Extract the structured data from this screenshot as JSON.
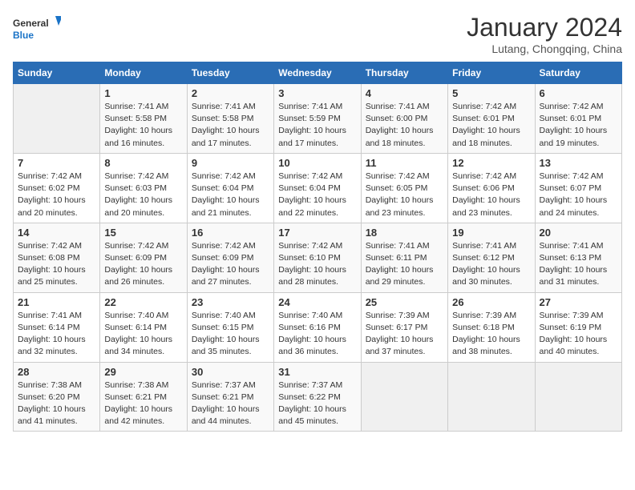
{
  "header": {
    "logo_line1": "General",
    "logo_line2": "Blue",
    "month_year": "January 2024",
    "location": "Lutang, Chongqing, China"
  },
  "columns": [
    "Sunday",
    "Monday",
    "Tuesday",
    "Wednesday",
    "Thursday",
    "Friday",
    "Saturday"
  ],
  "weeks": [
    [
      {
        "day": "",
        "info": ""
      },
      {
        "day": "1",
        "info": "Sunrise: 7:41 AM\nSunset: 5:58 PM\nDaylight: 10 hours\nand 16 minutes."
      },
      {
        "day": "2",
        "info": "Sunrise: 7:41 AM\nSunset: 5:58 PM\nDaylight: 10 hours\nand 17 minutes."
      },
      {
        "day": "3",
        "info": "Sunrise: 7:41 AM\nSunset: 5:59 PM\nDaylight: 10 hours\nand 17 minutes."
      },
      {
        "day": "4",
        "info": "Sunrise: 7:41 AM\nSunset: 6:00 PM\nDaylight: 10 hours\nand 18 minutes."
      },
      {
        "day": "5",
        "info": "Sunrise: 7:42 AM\nSunset: 6:01 PM\nDaylight: 10 hours\nand 18 minutes."
      },
      {
        "day": "6",
        "info": "Sunrise: 7:42 AM\nSunset: 6:01 PM\nDaylight: 10 hours\nand 19 minutes."
      }
    ],
    [
      {
        "day": "7",
        "info": "Sunrise: 7:42 AM\nSunset: 6:02 PM\nDaylight: 10 hours\nand 20 minutes."
      },
      {
        "day": "8",
        "info": "Sunrise: 7:42 AM\nSunset: 6:03 PM\nDaylight: 10 hours\nand 20 minutes."
      },
      {
        "day": "9",
        "info": "Sunrise: 7:42 AM\nSunset: 6:04 PM\nDaylight: 10 hours\nand 21 minutes."
      },
      {
        "day": "10",
        "info": "Sunrise: 7:42 AM\nSunset: 6:04 PM\nDaylight: 10 hours\nand 22 minutes."
      },
      {
        "day": "11",
        "info": "Sunrise: 7:42 AM\nSunset: 6:05 PM\nDaylight: 10 hours\nand 23 minutes."
      },
      {
        "day": "12",
        "info": "Sunrise: 7:42 AM\nSunset: 6:06 PM\nDaylight: 10 hours\nand 23 minutes."
      },
      {
        "day": "13",
        "info": "Sunrise: 7:42 AM\nSunset: 6:07 PM\nDaylight: 10 hours\nand 24 minutes."
      }
    ],
    [
      {
        "day": "14",
        "info": "Sunrise: 7:42 AM\nSunset: 6:08 PM\nDaylight: 10 hours\nand 25 minutes."
      },
      {
        "day": "15",
        "info": "Sunrise: 7:42 AM\nSunset: 6:09 PM\nDaylight: 10 hours\nand 26 minutes."
      },
      {
        "day": "16",
        "info": "Sunrise: 7:42 AM\nSunset: 6:09 PM\nDaylight: 10 hours\nand 27 minutes."
      },
      {
        "day": "17",
        "info": "Sunrise: 7:42 AM\nSunset: 6:10 PM\nDaylight: 10 hours\nand 28 minutes."
      },
      {
        "day": "18",
        "info": "Sunrise: 7:41 AM\nSunset: 6:11 PM\nDaylight: 10 hours\nand 29 minutes."
      },
      {
        "day": "19",
        "info": "Sunrise: 7:41 AM\nSunset: 6:12 PM\nDaylight: 10 hours\nand 30 minutes."
      },
      {
        "day": "20",
        "info": "Sunrise: 7:41 AM\nSunset: 6:13 PM\nDaylight: 10 hours\nand 31 minutes."
      }
    ],
    [
      {
        "day": "21",
        "info": "Sunrise: 7:41 AM\nSunset: 6:14 PM\nDaylight: 10 hours\nand 32 minutes."
      },
      {
        "day": "22",
        "info": "Sunrise: 7:40 AM\nSunset: 6:14 PM\nDaylight: 10 hours\nand 34 minutes."
      },
      {
        "day": "23",
        "info": "Sunrise: 7:40 AM\nSunset: 6:15 PM\nDaylight: 10 hours\nand 35 minutes."
      },
      {
        "day": "24",
        "info": "Sunrise: 7:40 AM\nSunset: 6:16 PM\nDaylight: 10 hours\nand 36 minutes."
      },
      {
        "day": "25",
        "info": "Sunrise: 7:39 AM\nSunset: 6:17 PM\nDaylight: 10 hours\nand 37 minutes."
      },
      {
        "day": "26",
        "info": "Sunrise: 7:39 AM\nSunset: 6:18 PM\nDaylight: 10 hours\nand 38 minutes."
      },
      {
        "day": "27",
        "info": "Sunrise: 7:39 AM\nSunset: 6:19 PM\nDaylight: 10 hours\nand 40 minutes."
      }
    ],
    [
      {
        "day": "28",
        "info": "Sunrise: 7:38 AM\nSunset: 6:20 PM\nDaylight: 10 hours\nand 41 minutes."
      },
      {
        "day": "29",
        "info": "Sunrise: 7:38 AM\nSunset: 6:21 PM\nDaylight: 10 hours\nand 42 minutes."
      },
      {
        "day": "30",
        "info": "Sunrise: 7:37 AM\nSunset: 6:21 PM\nDaylight: 10 hours\nand 44 minutes."
      },
      {
        "day": "31",
        "info": "Sunrise: 7:37 AM\nSunset: 6:22 PM\nDaylight: 10 hours\nand 45 minutes."
      },
      {
        "day": "",
        "info": ""
      },
      {
        "day": "",
        "info": ""
      },
      {
        "day": "",
        "info": ""
      }
    ]
  ]
}
